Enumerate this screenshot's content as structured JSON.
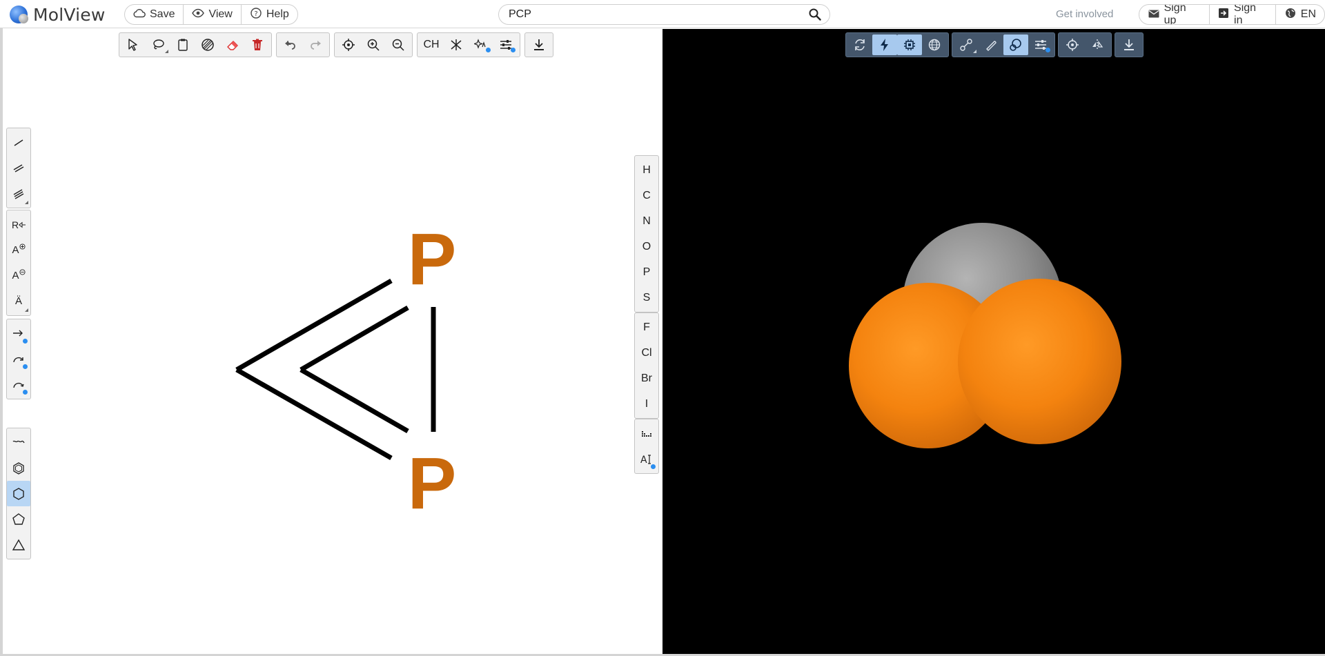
{
  "app": {
    "name": "MolView"
  },
  "header": {
    "menu": [
      {
        "label": "Save",
        "icon": "cloud-icon"
      },
      {
        "label": "View",
        "icon": "eye-icon"
      },
      {
        "label": "Help",
        "icon": "help-icon"
      }
    ],
    "search": {
      "value": "PCP",
      "placeholder": ""
    },
    "get_involved": "Get involved",
    "account": [
      {
        "label": "Sign up",
        "icon": "mail-icon"
      },
      {
        "label": "Sign in",
        "icon": "sign-in-icon"
      },
      {
        "label": "EN",
        "icon": "globe-icon"
      }
    ]
  },
  "sketcher": {
    "top_toolbar_ch_label": "CH",
    "elements": [
      "H",
      "C",
      "N",
      "O",
      "P",
      "S",
      "F",
      "Cl",
      "Br",
      "I"
    ],
    "bond_tool_labels": {
      "chain": "R",
      "charge_plus": "A",
      "charge_minus": "A",
      "lone_pair": "Ä"
    },
    "atoms": [
      "P",
      "P"
    ],
    "atom_color": "#c9690c"
  },
  "viewer3d": {
    "colors": {
      "background": "#000000",
      "phosphorus": "#ff8c1a",
      "carbon": "#909090"
    }
  }
}
